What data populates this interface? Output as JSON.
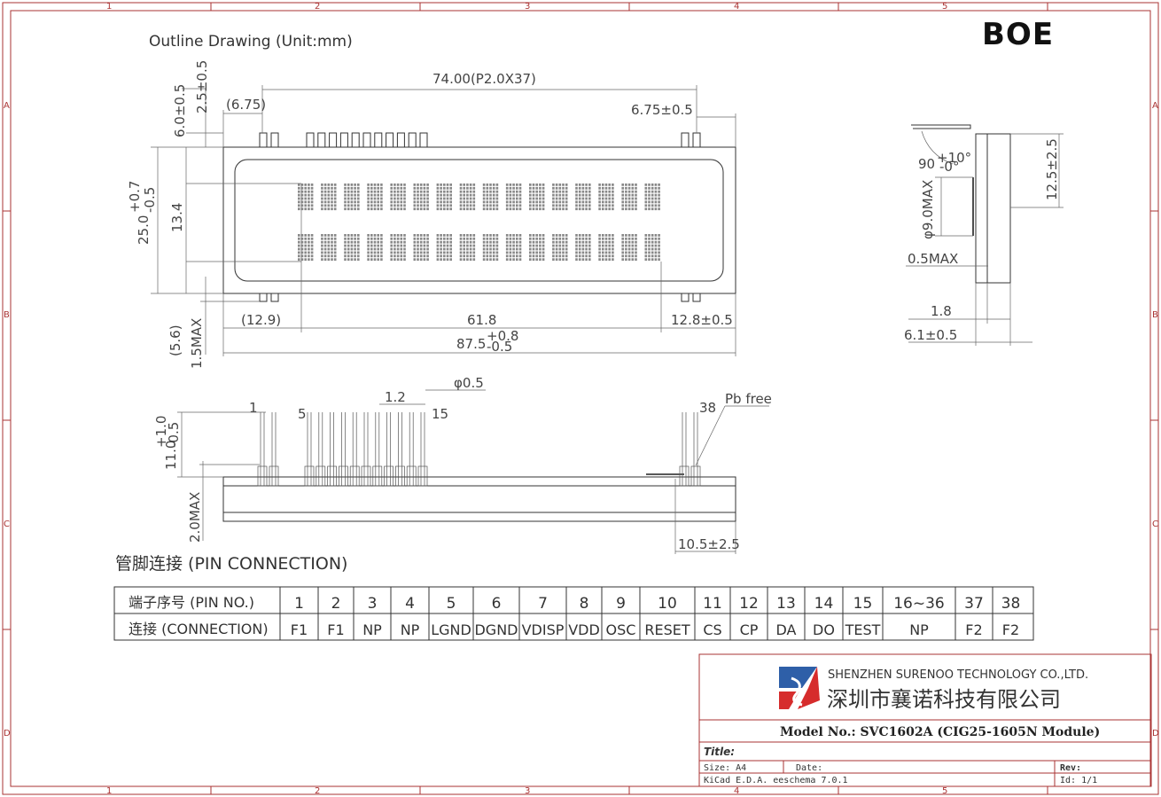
{
  "drawing": {
    "brand": "BOE",
    "title": "Outline Drawing (Unit:mm)",
    "col_marks": [
      "1",
      "2",
      "3",
      "4",
      "5"
    ],
    "row_marks": [
      "A",
      "B",
      "C",
      "D"
    ],
    "front_view": {
      "dims": {
        "pitch": "74.00(P2.0X37)",
        "left_pin_offset": "(6.75)",
        "right_pin_offset": "6.75±0.5",
        "pin_top_height": "6.0±0.5",
        "pin_top_small": "2.5±0.5",
        "height": "25.0",
        "height_tol_upper": "+0.7",
        "height_tol_lower": "-0.5",
        "view_area_height": "13.4",
        "bottom_gap": "(5.6)",
        "bottom_max": "1.5MAX",
        "left_view_offset": "(12.9)",
        "view_width": "61.8",
        "right_view_offset": "12.8±0.5",
        "width": "87.5",
        "width_tol_upper": "+0.8",
        "width_tol_lower": "-0.5"
      },
      "char_rows": 2,
      "char_cols": 16
    },
    "side_view": {
      "angle": "90",
      "angle_tol_upper": "+10°",
      "angle_tol_lower": "-0°",
      "right_dim": "12.5±2.5",
      "diameter": "φ9.0MAX",
      "thickness_max": "0.5MAX",
      "dim_1": "1.8",
      "dim_2": "6.1±0.5"
    },
    "pin_view": {
      "label_pin1": "1",
      "label_pin5": "5",
      "label_pin15": "15",
      "label_pin38": "38",
      "pitch": "1.2",
      "pin_diameter": "φ0.5",
      "pb_free": "Pb free",
      "pin_length": "11.0",
      "pin_len_tol_upper": "+1.0",
      "pin_len_tol_lower": "-0.5",
      "bottom_max": "2.0MAX",
      "right_dim": "10.5±2.5"
    }
  },
  "pin_section": {
    "title": "管脚连接 (PIN CONNECTION)",
    "row_pin_label": "端子序号  (PIN NO.)",
    "row_conn_label": "连接 (CONNECTION)",
    "pins": [
      {
        "no": "1",
        "conn": "F1"
      },
      {
        "no": "2",
        "conn": "F1"
      },
      {
        "no": "3",
        "conn": "NP"
      },
      {
        "no": "4",
        "conn": "NP"
      },
      {
        "no": "5",
        "conn": "LGND"
      },
      {
        "no": "6",
        "conn": "DGND"
      },
      {
        "no": "7",
        "conn": "VDISP"
      },
      {
        "no": "8",
        "conn": "VDD"
      },
      {
        "no": "9",
        "conn": "OSC"
      },
      {
        "no": "10",
        "conn": "RESET"
      },
      {
        "no": "11",
        "conn": "CS"
      },
      {
        "no": "12",
        "conn": "CP"
      },
      {
        "no": "13",
        "conn": "DA"
      },
      {
        "no": "14",
        "conn": "DO"
      },
      {
        "no": "15",
        "conn": "TEST"
      },
      {
        "no": "16~36",
        "conn": "NP"
      },
      {
        "no": "37",
        "conn": "F2"
      },
      {
        "no": "38",
        "conn": "F2"
      }
    ]
  },
  "title_block": {
    "company_en": "SHENZHEN SURENOO TECHNOLOGY CO.,LTD.",
    "company_cn": "深圳市襄诺科技有限公司",
    "model": "Model No.: SVC1602A (CIG25-1605N Module)",
    "title_label": "Title:",
    "size": "Size: A4",
    "date": "Date:",
    "rev": "Rev:",
    "tool": "KiCad E.D.A.  eeschema 7.0.1",
    "id": "Id: 1/1"
  },
  "colors": {
    "frame": "#aa3333",
    "logo_red": "#d62c2c",
    "logo_blue": "#2e5fa8"
  }
}
